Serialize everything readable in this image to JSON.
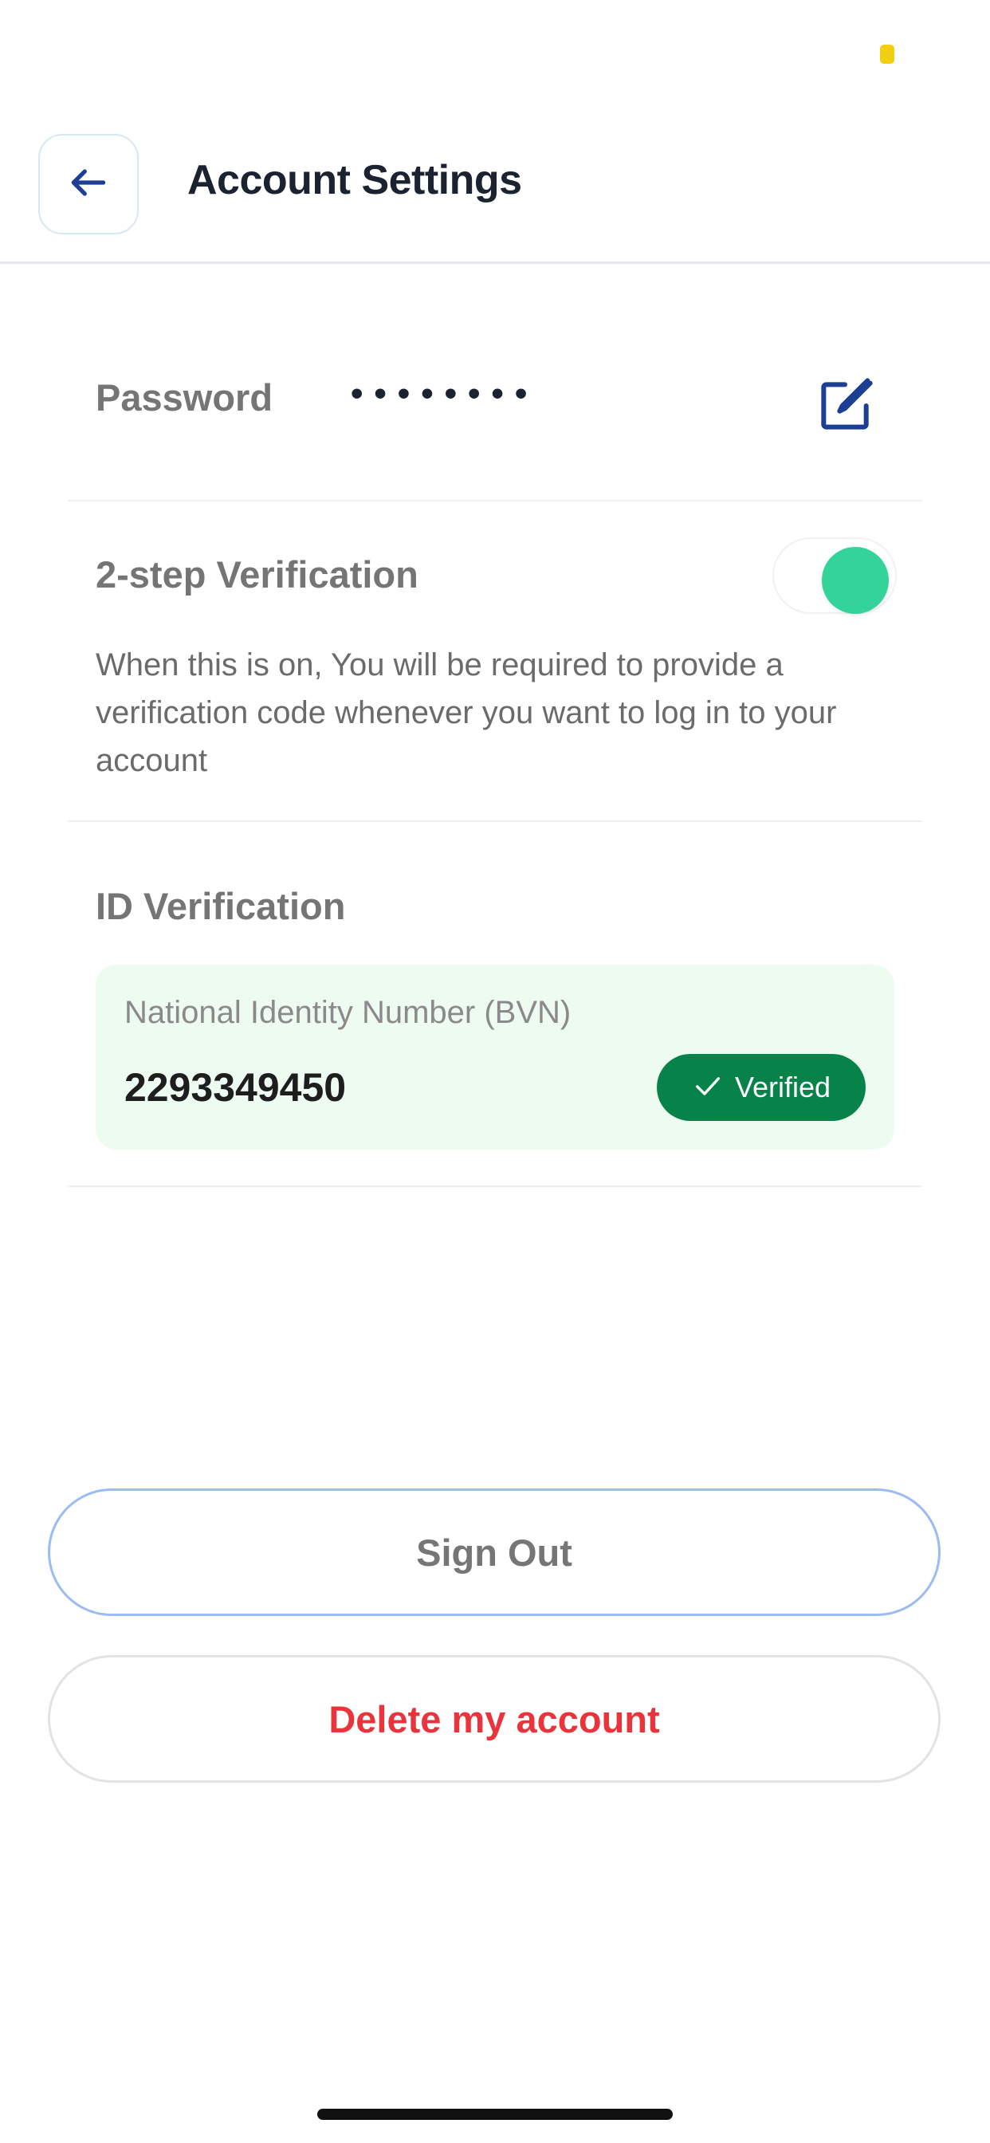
{
  "colors": {
    "accent_green": "#34d399",
    "verified_green": "#07834a",
    "danger_red": "#e9343b",
    "title_dark": "#1b2330",
    "icon_blue": "#1c3f94"
  },
  "header": {
    "title": "Account Settings",
    "back_icon": "arrow-left-icon"
  },
  "password": {
    "label": "Password",
    "masked_value": "••••••••",
    "edit_icon": "edit-icon"
  },
  "two_step": {
    "label": "2-step Verification",
    "enabled": true,
    "description": "When this is on, You will be required to provide a verification code whenever you want to log in to your account"
  },
  "id_verification": {
    "heading": "ID Verification",
    "card_label": "National Identity Number (BVN)",
    "number": "2293349450",
    "status": "Verified",
    "status_icon": "check-icon"
  },
  "actions": {
    "sign_out": "Sign Out",
    "delete_account": "Delete my account"
  }
}
